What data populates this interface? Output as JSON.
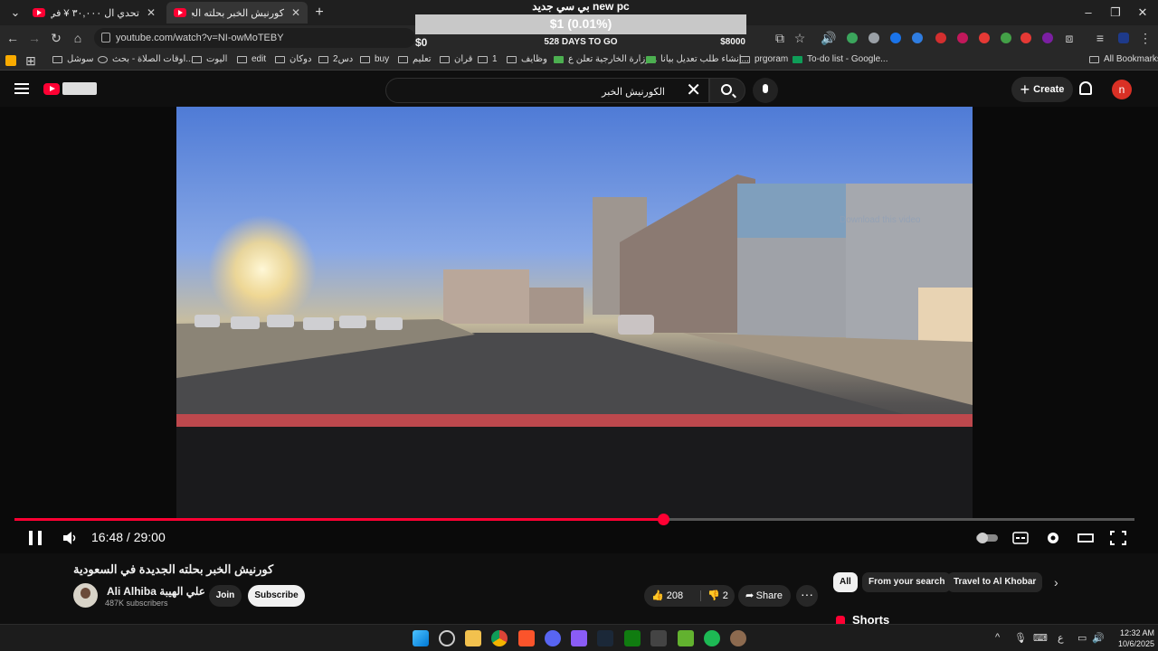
{
  "browser": {
    "tabs": [
      {
        "title": "تحدي ال ٣٠,٠٠٠ ¥ في الاركيد الياب...",
        "active": false
      },
      {
        "title": "كورنيش الخبر بحلته الجديدة ف...",
        "active": true
      }
    ],
    "new_tab": "+",
    "url": "youtube.com/watch?v=NI-owMoTEBY",
    "bookmarks": [
      "سوشل",
      "اوقات الصلاة - بحث...",
      "اليوت",
      "edit",
      "دوكان",
      "دس2",
      "buy",
      "تعليم",
      "قران",
      "1",
      "وظايف",
      "وزارة الخارجية تعلن ع...",
      "إنشاء طلب تعديل بيانا...",
      "prgoram",
      "To-do list - Google..."
    ],
    "all_bookmarks": "All Bookmarks"
  },
  "goal_overlay": {
    "title": "بي سي جديد new pc",
    "progress_text": "$1 (0.01%)",
    "progress_fraction": 0.0001,
    "min_label": "$0",
    "days_label": "528 DAYS TO GO",
    "max_label": "$8000"
  },
  "youtube": {
    "search_value": "الكورنيش الخبر",
    "create_label": "Create",
    "avatar_letter": "n",
    "watermark": "Download this video",
    "player": {
      "time": "16:48 / 29:00",
      "progress_fraction": 0.579
    },
    "video_title": "كورنيش الخبر بحلته الجديدة في السعودية",
    "channel": {
      "name": "Ali Alhiba علي الهيبة",
      "subscribers": "487K subscribers"
    },
    "join_label": "Join",
    "subscribe_label": "Subscribe",
    "likes": "208",
    "dislikes": "2",
    "share_label": "Share",
    "more_label": "···",
    "chips": [
      "All",
      "From your search",
      "Travel to Al Khobar"
    ],
    "shorts_label": "Shorts"
  },
  "taskbar": {
    "time": "12:32 AM",
    "date": "10/6/2025",
    "lang": "ع"
  },
  "colors": {
    "accent": "#ff0033",
    "background": "#0f0f0f"
  }
}
